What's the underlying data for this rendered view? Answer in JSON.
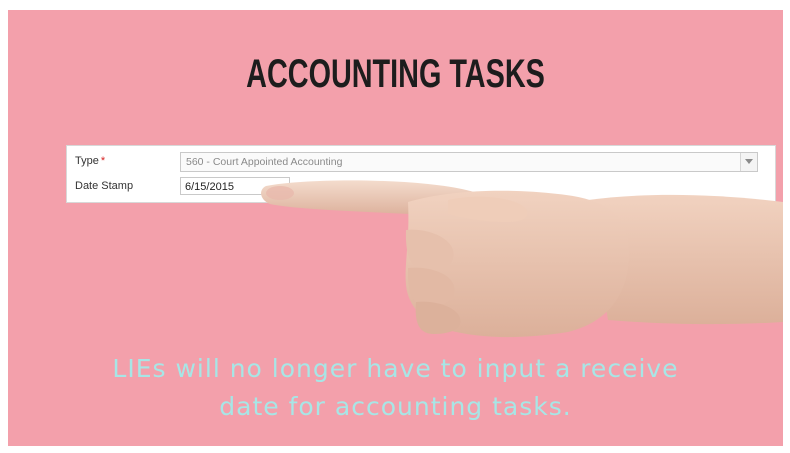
{
  "slide": {
    "title": "ACCOUNTING TASKS",
    "caption_line1": "LIEs will no longer have to input a receive",
    "caption_line2": "date for accounting tasks."
  },
  "form": {
    "type_label": "Type",
    "required_mark": "*",
    "type_value": "560 - Court Appointed Accounting",
    "date_label": "Date Stamp",
    "date_value": "6/15/2015"
  },
  "colors": {
    "background": "#f3a0ab",
    "caption": "#a7e6e6",
    "required": "#d61f1f"
  },
  "icons": {
    "dropdown": "chevron-down-icon",
    "hand": "pointing-hand-image"
  }
}
